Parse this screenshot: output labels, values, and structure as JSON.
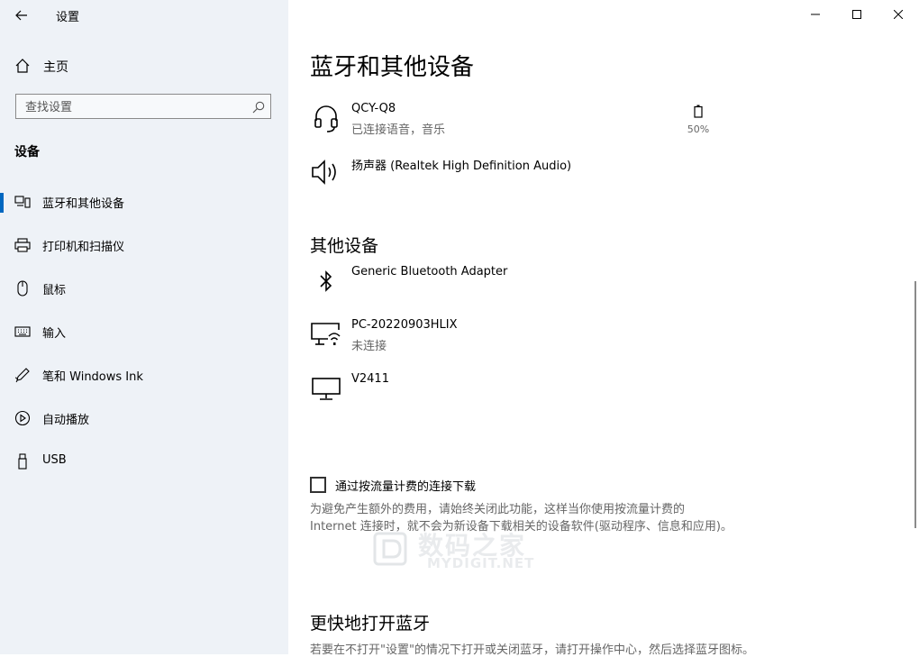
{
  "sidebar": {
    "app_title": "设置",
    "home_label": "主页",
    "search_placeholder": "查找设置",
    "section_title": "设备",
    "items": [
      {
        "label": "蓝牙和其他设备",
        "icon": "bluetooth-devices-icon",
        "active": true
      },
      {
        "label": "打印机和扫描仪",
        "icon": "printer-icon"
      },
      {
        "label": "鼠标",
        "icon": "mouse-icon"
      },
      {
        "label": "输入",
        "icon": "keyboard-icon"
      },
      {
        "label": "笔和 Windows Ink",
        "icon": "pen-icon"
      },
      {
        "label": "自动播放",
        "icon": "autoplay-icon"
      },
      {
        "label": "USB",
        "icon": "usb-icon"
      }
    ]
  },
  "main": {
    "title": "蓝牙和其他设备",
    "audio_devices": [
      {
        "name": "QCY-Q8",
        "status": "已连接语音，音乐",
        "icon": "headset-icon",
        "battery": "50%"
      },
      {
        "name": "扬声器 (Realtek High Definition Audio)",
        "icon": "speaker-icon"
      }
    ],
    "other_title": "其他设备",
    "other_devices": [
      {
        "name": "Generic Bluetooth Adapter",
        "icon": "bluetooth-icon"
      },
      {
        "name": "PC-20220903HLIX",
        "status": "未连接",
        "icon": "network-display-icon"
      },
      {
        "name": "V2411",
        "icon": "monitor-icon"
      }
    ],
    "metered_label": "通过按流量计费的连接下载",
    "metered_desc": "为避免产生额外的费用，请始终关闭此功能，这样当你使用按流量计费的 Internet 连接时，就不会为新设备下载相关的设备软件(驱动程序、信息和应用)。",
    "watermark_cn": "数码之家",
    "watermark_en": "MYDIGIT.NET",
    "quick_title": "更快地打开蓝牙",
    "quick_desc": "若要在不打开\"设置\"的情况下打开或关闭蓝牙，请打开操作中心，然后选择蓝牙图标。"
  }
}
